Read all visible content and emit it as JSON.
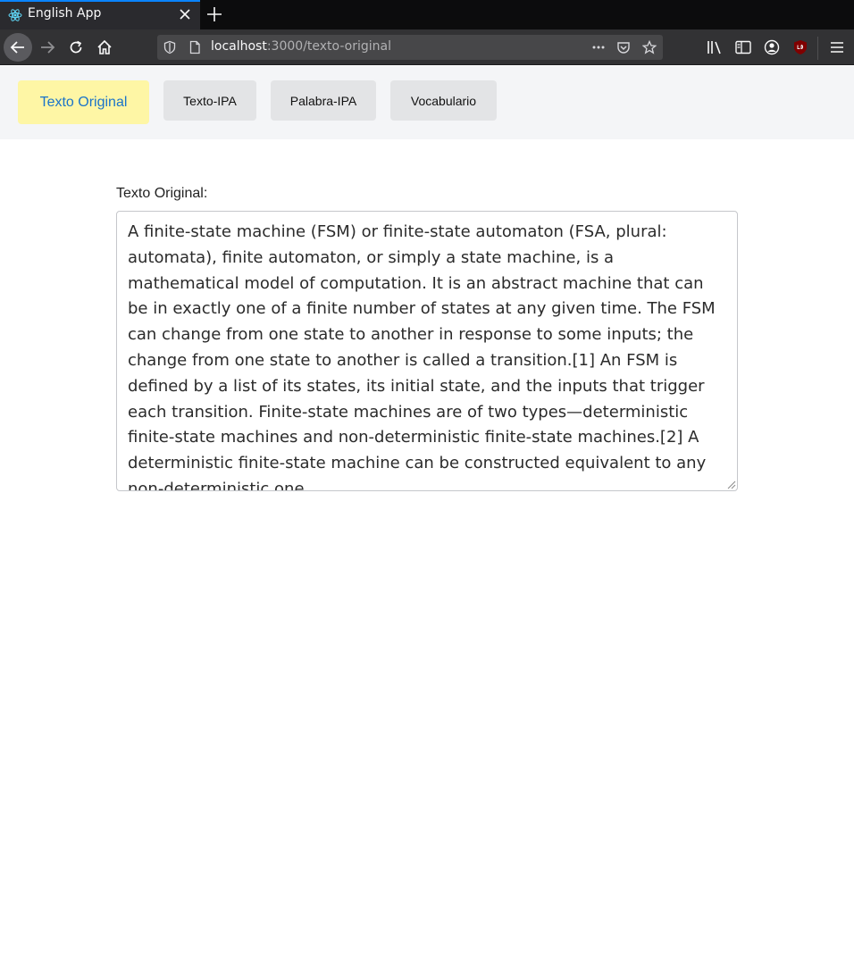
{
  "browser": {
    "tab_title": "English App",
    "url_host": "localhost",
    "url_path": ":3000/texto-original"
  },
  "nav": {
    "tabs": [
      {
        "label": "Texto Original",
        "active": true
      },
      {
        "label": "Texto-IPA",
        "active": false
      },
      {
        "label": "Palabra-IPA",
        "active": false
      },
      {
        "label": "Vocabulario",
        "active": false
      }
    ]
  },
  "main": {
    "label": "Texto Original:",
    "text": "A finite-state machine (FSM) or finite-state automaton (FSA, plural: automata), finite automaton, or simply a state machine, is a mathematical model of computation. It is an abstract machine that can be in exactly one of a finite number of states at any given time. The FSM can change from one state to another in response to some inputs; the change from one state to another is called a transition.[1] An FSM is defined by a list of its states, its initial state, and the inputs that trigger each transition. Finite-state machines are of two types—deterministic finite-state machines and non-deterministic finite-state machines.[2] A deterministic finite-state machine can be constructed equivalent to any non-deterministic one."
  },
  "colors": {
    "active_tab_bg": "#fef6a5",
    "active_tab_text": "#1b74c9",
    "tab_accent": "#0a84ff"
  }
}
